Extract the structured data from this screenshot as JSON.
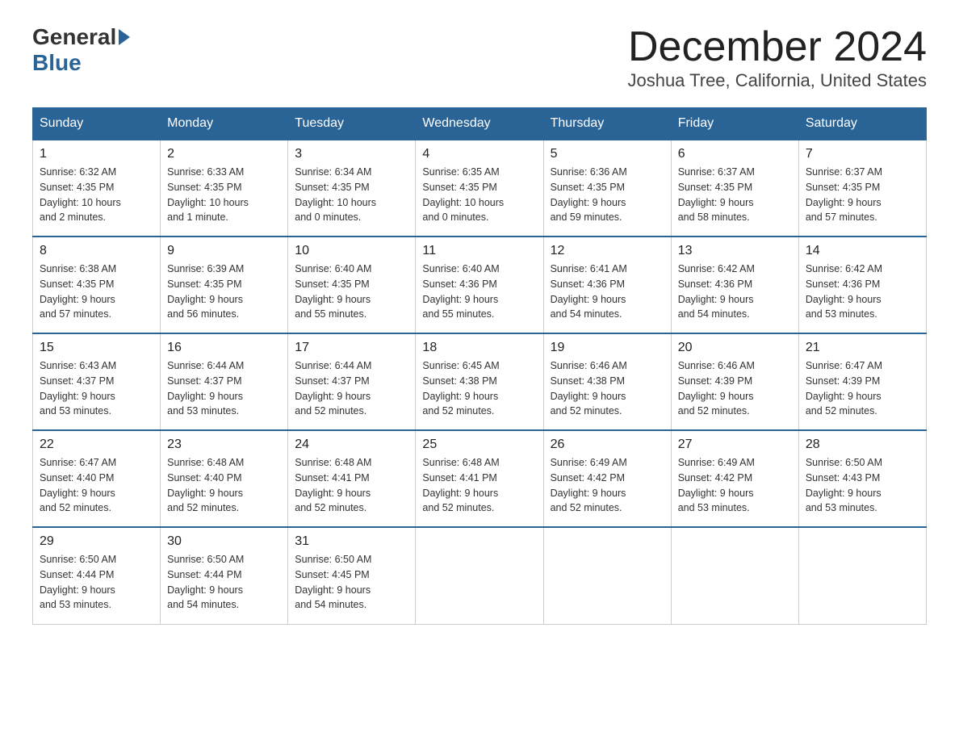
{
  "header": {
    "logo_general": "General",
    "logo_blue": "Blue",
    "month_title": "December 2024",
    "location": "Joshua Tree, California, United States"
  },
  "days_of_week": [
    "Sunday",
    "Monday",
    "Tuesday",
    "Wednesday",
    "Thursday",
    "Friday",
    "Saturday"
  ],
  "weeks": [
    [
      {
        "day": "1",
        "sunrise": "6:32 AM",
        "sunset": "4:35 PM",
        "daylight": "10 hours and 2 minutes."
      },
      {
        "day": "2",
        "sunrise": "6:33 AM",
        "sunset": "4:35 PM",
        "daylight": "10 hours and 1 minute."
      },
      {
        "day": "3",
        "sunrise": "6:34 AM",
        "sunset": "4:35 PM",
        "daylight": "10 hours and 0 minutes."
      },
      {
        "day": "4",
        "sunrise": "6:35 AM",
        "sunset": "4:35 PM",
        "daylight": "10 hours and 0 minutes."
      },
      {
        "day": "5",
        "sunrise": "6:36 AM",
        "sunset": "4:35 PM",
        "daylight": "9 hours and 59 minutes."
      },
      {
        "day": "6",
        "sunrise": "6:37 AM",
        "sunset": "4:35 PM",
        "daylight": "9 hours and 58 minutes."
      },
      {
        "day": "7",
        "sunrise": "6:37 AM",
        "sunset": "4:35 PM",
        "daylight": "9 hours and 57 minutes."
      }
    ],
    [
      {
        "day": "8",
        "sunrise": "6:38 AM",
        "sunset": "4:35 PM",
        "daylight": "9 hours and 57 minutes."
      },
      {
        "day": "9",
        "sunrise": "6:39 AM",
        "sunset": "4:35 PM",
        "daylight": "9 hours and 56 minutes."
      },
      {
        "day": "10",
        "sunrise": "6:40 AM",
        "sunset": "4:35 PM",
        "daylight": "9 hours and 55 minutes."
      },
      {
        "day": "11",
        "sunrise": "6:40 AM",
        "sunset": "4:36 PM",
        "daylight": "9 hours and 55 minutes."
      },
      {
        "day": "12",
        "sunrise": "6:41 AM",
        "sunset": "4:36 PM",
        "daylight": "9 hours and 54 minutes."
      },
      {
        "day": "13",
        "sunrise": "6:42 AM",
        "sunset": "4:36 PM",
        "daylight": "9 hours and 54 minutes."
      },
      {
        "day": "14",
        "sunrise": "6:42 AM",
        "sunset": "4:36 PM",
        "daylight": "9 hours and 53 minutes."
      }
    ],
    [
      {
        "day": "15",
        "sunrise": "6:43 AM",
        "sunset": "4:37 PM",
        "daylight": "9 hours and 53 minutes."
      },
      {
        "day": "16",
        "sunrise": "6:44 AM",
        "sunset": "4:37 PM",
        "daylight": "9 hours and 53 minutes."
      },
      {
        "day": "17",
        "sunrise": "6:44 AM",
        "sunset": "4:37 PM",
        "daylight": "9 hours and 52 minutes."
      },
      {
        "day": "18",
        "sunrise": "6:45 AM",
        "sunset": "4:38 PM",
        "daylight": "9 hours and 52 minutes."
      },
      {
        "day": "19",
        "sunrise": "6:46 AM",
        "sunset": "4:38 PM",
        "daylight": "9 hours and 52 minutes."
      },
      {
        "day": "20",
        "sunrise": "6:46 AM",
        "sunset": "4:39 PM",
        "daylight": "9 hours and 52 minutes."
      },
      {
        "day": "21",
        "sunrise": "6:47 AM",
        "sunset": "4:39 PM",
        "daylight": "9 hours and 52 minutes."
      }
    ],
    [
      {
        "day": "22",
        "sunrise": "6:47 AM",
        "sunset": "4:40 PM",
        "daylight": "9 hours and 52 minutes."
      },
      {
        "day": "23",
        "sunrise": "6:48 AM",
        "sunset": "4:40 PM",
        "daylight": "9 hours and 52 minutes."
      },
      {
        "day": "24",
        "sunrise": "6:48 AM",
        "sunset": "4:41 PM",
        "daylight": "9 hours and 52 minutes."
      },
      {
        "day": "25",
        "sunrise": "6:48 AM",
        "sunset": "4:41 PM",
        "daylight": "9 hours and 52 minutes."
      },
      {
        "day": "26",
        "sunrise": "6:49 AM",
        "sunset": "4:42 PM",
        "daylight": "9 hours and 52 minutes."
      },
      {
        "day": "27",
        "sunrise": "6:49 AM",
        "sunset": "4:42 PM",
        "daylight": "9 hours and 53 minutes."
      },
      {
        "day": "28",
        "sunrise": "6:50 AM",
        "sunset": "4:43 PM",
        "daylight": "9 hours and 53 minutes."
      }
    ],
    [
      {
        "day": "29",
        "sunrise": "6:50 AM",
        "sunset": "4:44 PM",
        "daylight": "9 hours and 53 minutes."
      },
      {
        "day": "30",
        "sunrise": "6:50 AM",
        "sunset": "4:44 PM",
        "daylight": "9 hours and 54 minutes."
      },
      {
        "day": "31",
        "sunrise": "6:50 AM",
        "sunset": "4:45 PM",
        "daylight": "9 hours and 54 minutes."
      },
      null,
      null,
      null,
      null
    ]
  ],
  "labels": {
    "sunrise": "Sunrise:",
    "sunset": "Sunset:",
    "daylight": "Daylight:"
  }
}
